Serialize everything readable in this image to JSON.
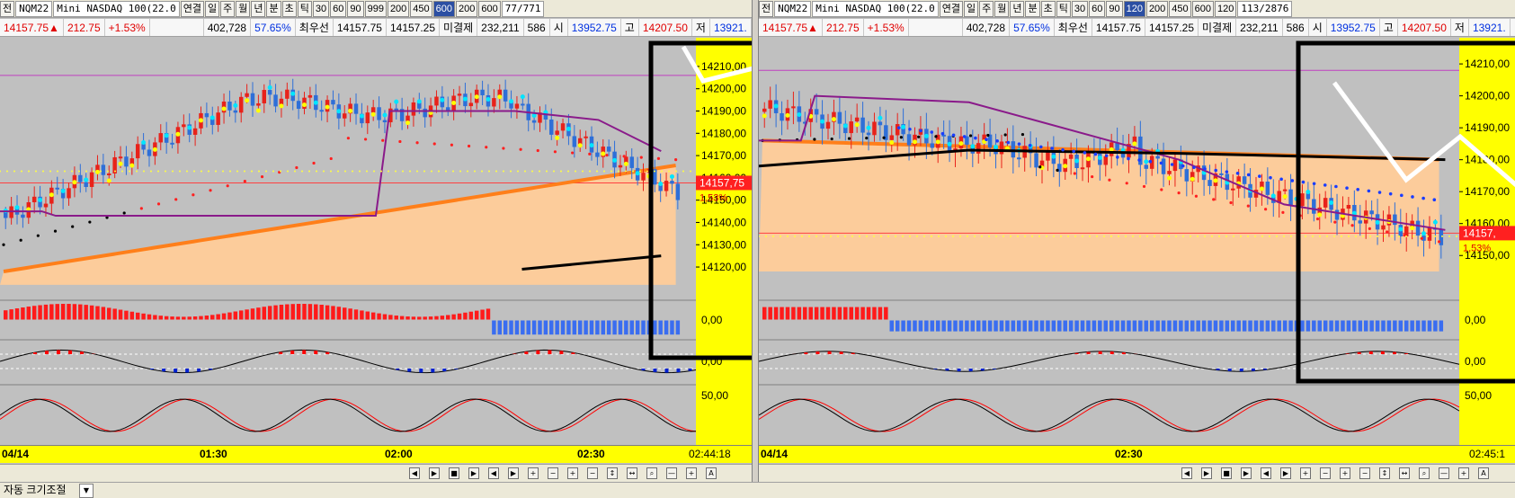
{
  "left": {
    "toolbar": [
      "전",
      "NQM22",
      "Mini NASDAQ 100(22.0",
      "연결",
      "일",
      "주",
      "월",
      "년",
      "분",
      "초",
      "틱",
      "30",
      "60",
      "90",
      "999",
      "200",
      "450",
      "600",
      "200",
      "600",
      "77/771"
    ],
    "selected_index": 17,
    "quote": {
      "price": "14157.75▲",
      "change": "212.75",
      "pct": "+1.53%",
      "volume": "402,728",
      "vol_pct": "57.65%",
      "best_label": "최우선",
      "ask": "14157.75",
      "bid": "14157.25",
      "oi_label": "미결제",
      "oi": "232,211",
      "oi_chg": "586",
      "open_label": "시",
      "open": "13952.75",
      "high_label": "고",
      "high": "14207.50",
      "low_label": "저",
      "low": "13921."
    },
    "price_ticks": [
      "14210,00",
      "14200,00",
      "14190,00",
      "14180,00",
      "14170,00",
      "14160,00",
      "14150,00",
      "14140,00",
      "14130,00",
      "14120,00"
    ],
    "current_price": "14157,75",
    "current_pct": "1,53%",
    "indicator_ticks": [
      "0,00",
      "0,00",
      "50,00"
    ],
    "time_labels": [
      "04/14",
      "01:30",
      "02:00",
      "02:30"
    ],
    "clock": "02:44:18"
  },
  "right": {
    "toolbar": [
      "전",
      "NQM22",
      "Mini NASDAQ 100(22.0",
      "연결",
      "일",
      "주",
      "월",
      "년",
      "분",
      "초",
      "틱",
      "30",
      "60",
      "90",
      "120",
      "200",
      "450",
      "600",
      "120",
      "113/2876"
    ],
    "selected_index": 14,
    "quote": {
      "price": "14157.75▲",
      "change": "212.75",
      "pct": "+1.53%",
      "volume": "402,728",
      "vol_pct": "57.65%",
      "best_label": "최우선",
      "ask": "14157.75",
      "bid": "14157.25",
      "oi_label": "미결제",
      "oi": "232,211",
      "oi_chg": "586",
      "open_label": "시",
      "open": "13952.75",
      "high_label": "고",
      "high": "14207.50",
      "low_label": "저",
      "low": "13921."
    },
    "price_ticks": [
      "14210,00",
      "14200,00",
      "14190,00",
      "14180,00",
      "14170,00",
      "14160,00",
      "14150,00"
    ],
    "current_price": "14157,",
    "current_pct": "1,53%",
    "indicator_ticks": [
      "0,00",
      "0,00",
      "50,00"
    ],
    "time_labels": [
      "04/14",
      "02:30"
    ],
    "clock": "02:45:1"
  },
  "bottom": {
    "auto_size_label": "자동 크기조절"
  },
  "colors": {
    "up_candle": "#e8221a",
    "down_candle": "#2e6fd8",
    "background": "#c0c0c0",
    "axis": "#ffff00",
    "fill": "#ffcc99"
  }
}
